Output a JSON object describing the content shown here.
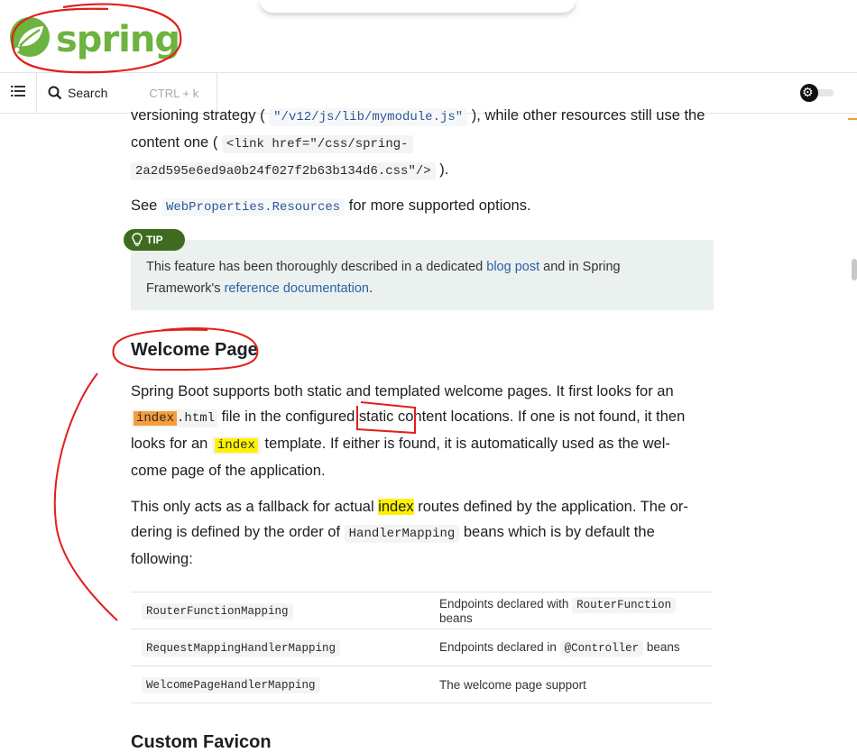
{
  "brand": {
    "name": "spring",
    "color": "#6db33f"
  },
  "nav": {
    "toc_icon": "list-icon",
    "search_icon": "search-icon",
    "search_label": "Search",
    "search_shortcut": "CTRL + k",
    "theme_toggle_icon": "gear-icon"
  },
  "intro": {
    "line1_prefix": "versioning strategy ( ",
    "line1_code": "\"/v12/js/lib/mymodule.js\"",
    "line1_suffix": " ), while other resources still use the",
    "line2_prefix": "content one ( ",
    "line2_code": "<link href=\"/css/spring-",
    "line3_code": "2a2d595e6ed9a0b24f027f2b63b134d6.css\"/>",
    "line3_suffix": " )."
  },
  "see_line": {
    "prefix": "See ",
    "code": "WebProperties.Resources",
    "suffix": " for more supported options."
  },
  "tip": {
    "icon": "lightbulb-icon",
    "label": "TIP",
    "text_1": "This feature has been thoroughly described in a dedicated ",
    "link_1": "blog post",
    "text_2": " and in Spring",
    "text_3": "Framework's ",
    "link_2": "reference documentation",
    "text_4": "."
  },
  "welcome": {
    "heading": "Welcome Page",
    "p1_a": "Spring Boot supports both static and templated welcome pages. It first looks for an",
    "p1_hl1": "index",
    "p1_code_rest": ".html",
    "p1_b": " file in the configured static content locations. If one is not found, it then",
    "p1_c": "looks for an ",
    "p1_hl2": "index",
    "p1_d": " template. If either is found, it is automatically used as the wel-",
    "p1_e": "come page of the application.",
    "p2_a": "This only acts as a fallback for actual ",
    "p2_hl": "index",
    "p2_b": " routes defined by the application. The or-",
    "p2_c": "dering is defined by the order of ",
    "p2_code": "HandlerMapping",
    "p2_d": " beans which is by default the",
    "p2_e": "following:"
  },
  "mapping_table": {
    "rows": [
      {
        "name": "RouterFunctionMapping",
        "desc_prefix": "Endpoints declared with ",
        "desc_code": "RouterFunction",
        "desc_suffix": " beans"
      },
      {
        "name": "RequestMappingHandlerMapping",
        "desc_prefix": "Endpoints declared in ",
        "desc_code": "@Controller",
        "desc_suffix": " beans"
      },
      {
        "name": "WelcomePageHandlerMapping",
        "desc_prefix": "The welcome page support",
        "desc_code": "",
        "desc_suffix": ""
      }
    ]
  },
  "next_heading": "Custom Favicon",
  "colors": {
    "annotation_red": "#e0201c",
    "tip_badge": "#3e6b1f",
    "tip_bg": "#ebf1ef",
    "highlight_orange": "#f59d3a",
    "highlight_yellow": "#fff200"
  }
}
